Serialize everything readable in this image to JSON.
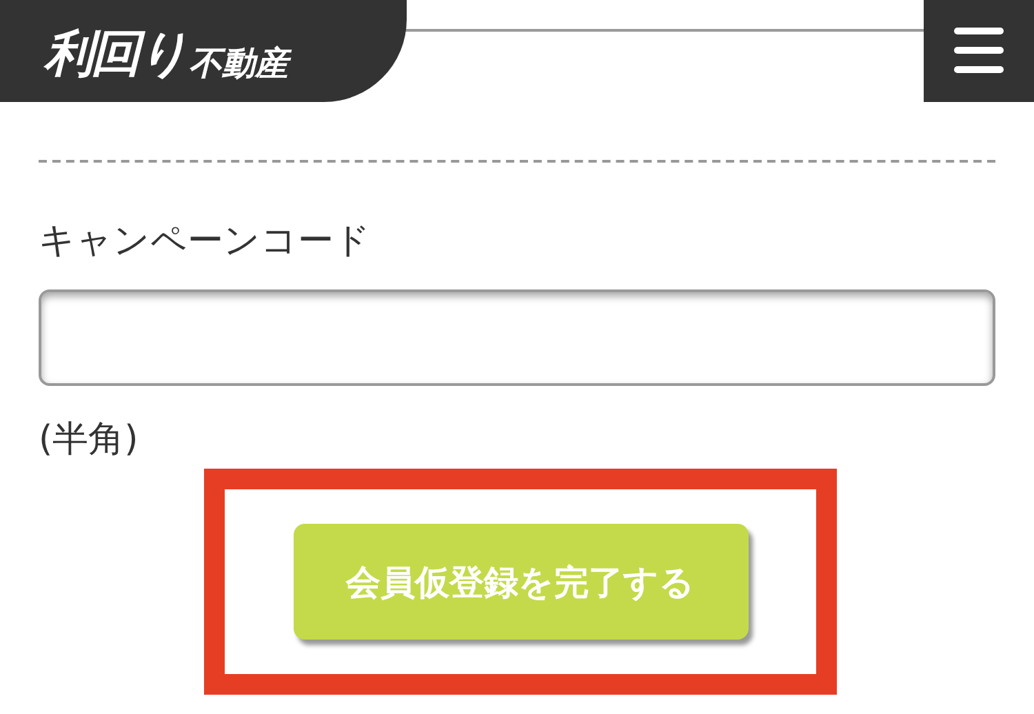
{
  "header": {
    "logo_main": "利回り",
    "logo_sub": "不動産"
  },
  "form": {
    "field_label": "キャンペーンコード",
    "field_note": "(半角)"
  },
  "submit": {
    "label": "会員仮登録を完了する",
    "highlighted": true
  }
}
